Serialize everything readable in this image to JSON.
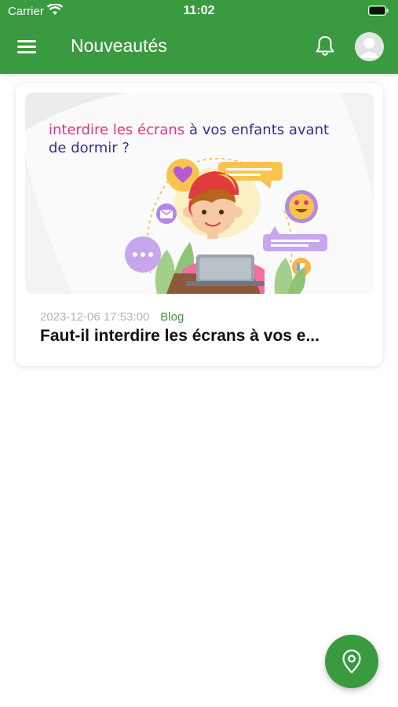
{
  "status_bar": {
    "carrier": "Carrier",
    "time": "11:02"
  },
  "header": {
    "title": "Nouveautés"
  },
  "icons": {
    "menu": "menu-icon",
    "notifications": "bell-icon",
    "profile": "avatar-icon",
    "wifi": "wifi-icon",
    "battery": "battery-icon",
    "location": "map-pin-icon"
  },
  "colors": {
    "brand_green": "#3a9a3f",
    "headline_purple": "#3b2c8f",
    "headline_pink": "#e8317b"
  },
  "articles": [
    {
      "image_headline_highlight": "interdire les écrans",
      "image_headline_rest": " à vos enfants avant de dormir ?",
      "date": "2023-12-06 17:53:00",
      "category": "Blog",
      "title": "Faut-il interdire les écrans à vos e..."
    }
  ]
}
